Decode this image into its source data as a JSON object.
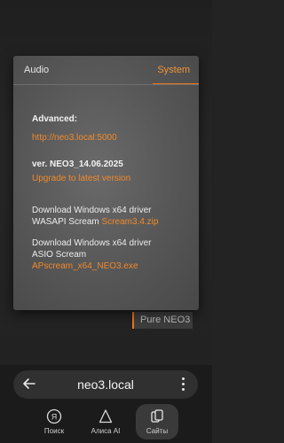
{
  "tabs": {
    "audio": "Audio",
    "system": "System"
  },
  "system": {
    "advanced_label": "Advanced:",
    "advanced_link": "http://neo3.local:5000",
    "version": "ver. NEO3_14.06.2025",
    "upgrade_link": "Upgrade to latest version",
    "driver1_line1": "Download Windows x64 driver",
    "driver1_line2_prefix": "WASAPI Scream ",
    "driver1_link": "Scream3.4.zip",
    "driver2_line1": "Download Windows x64 driver",
    "driver2_line2": "ASIO Scream",
    "driver2_link": "APscream_x64_NEO3.exe"
  },
  "background": {
    "badge": "Pure NEO3"
  },
  "browser": {
    "url": "neo3.local",
    "nav": {
      "search": "Поиск",
      "alice": "Алиса AI",
      "sites": "Сайты"
    }
  },
  "colors": {
    "accent": "#e87722",
    "link": "#f08a2c",
    "card": "#5a5a5a",
    "bar": "#1b1b1b"
  }
}
